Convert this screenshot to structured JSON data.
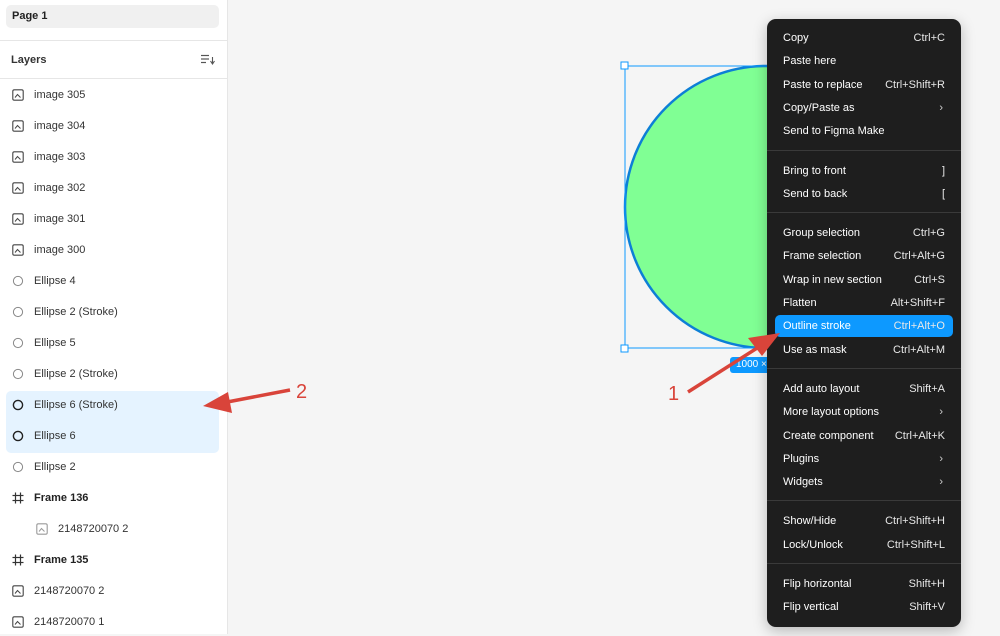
{
  "page_tab": {
    "label": "Page 1"
  },
  "layers_panel": {
    "title": "Layers",
    "items": [
      {
        "label": "image 305",
        "icon": "image-icon"
      },
      {
        "label": "image 304",
        "icon": "image-icon"
      },
      {
        "label": "image 303",
        "icon": "image-icon"
      },
      {
        "label": "image 302",
        "icon": "image-icon"
      },
      {
        "label": "image 301",
        "icon": "image-icon"
      },
      {
        "label": "image 300",
        "icon": "image-icon"
      },
      {
        "label": "Ellipse 4",
        "icon": "ellipse-icon"
      },
      {
        "label": "Ellipse 2 (Stroke)",
        "icon": "ellipse-icon"
      },
      {
        "label": "Ellipse 5",
        "icon": "ellipse-icon"
      },
      {
        "label": "Ellipse 2 (Stroke)",
        "icon": "ellipse-icon"
      },
      {
        "label": "Ellipse 6 (Stroke)",
        "icon": "ellipse-icon",
        "selected": true
      },
      {
        "label": "Ellipse 6",
        "icon": "ellipse-icon",
        "selected": true
      },
      {
        "label": "Ellipse 2",
        "icon": "ellipse-icon"
      },
      {
        "label": "Frame 136",
        "icon": "frame-icon"
      },
      {
        "label": "2148720070 2",
        "icon": "image-icon"
      },
      {
        "label": "Frame 135",
        "icon": "frame-icon"
      },
      {
        "label": "2148720070 2",
        "icon": "image-icon"
      },
      {
        "label": "2148720070 1",
        "icon": "image-icon"
      }
    ]
  },
  "canvas": {
    "shape_fill": "#80ff94",
    "shape_stroke": "#0d7fd6",
    "selection_color": "#0d99ff",
    "dimension_badge": "1000 ×"
  },
  "context_menu": {
    "groups": [
      [
        {
          "label": "Copy",
          "shortcut": "Ctrl+C"
        },
        {
          "label": "Paste here",
          "shortcut": ""
        },
        {
          "label": "Paste to replace",
          "shortcut": "Ctrl+Shift+R"
        },
        {
          "label": "Copy/Paste as",
          "shortcut": "",
          "submenu": true
        },
        {
          "label": "Send to Figma Make",
          "shortcut": ""
        }
      ],
      [
        {
          "label": "Bring to front",
          "shortcut": "]"
        },
        {
          "label": "Send to back",
          "shortcut": "["
        }
      ],
      [
        {
          "label": "Group selection",
          "shortcut": "Ctrl+G"
        },
        {
          "label": "Frame selection",
          "shortcut": "Ctrl+Alt+G"
        },
        {
          "label": "Wrap in new section",
          "shortcut": "Ctrl+S"
        },
        {
          "label": "Flatten",
          "shortcut": "Alt+Shift+F"
        },
        {
          "label": "Outline stroke",
          "shortcut": "Ctrl+Alt+O",
          "highlighted": true
        },
        {
          "label": "Use as mask",
          "shortcut": "Ctrl+Alt+M"
        }
      ],
      [
        {
          "label": "Add auto layout",
          "shortcut": "Shift+A"
        },
        {
          "label": "More layout options",
          "shortcut": "",
          "submenu": true
        },
        {
          "label": "Create component",
          "shortcut": "Ctrl+Alt+K"
        },
        {
          "label": "Plugins",
          "shortcut": "",
          "submenu": true
        },
        {
          "label": "Widgets",
          "shortcut": "",
          "submenu": true
        }
      ],
      [
        {
          "label": "Show/Hide",
          "shortcut": "Ctrl+Shift+H"
        },
        {
          "label": "Lock/Unlock",
          "shortcut": "Ctrl+Shift+L"
        }
      ],
      [
        {
          "label": "Flip horizontal",
          "shortcut": "Shift+H"
        },
        {
          "label": "Flip vertical",
          "shortcut": "Shift+V"
        }
      ]
    ]
  },
  "annotations": {
    "number_1": "1",
    "number_2": "2",
    "color": "#d9443a"
  }
}
